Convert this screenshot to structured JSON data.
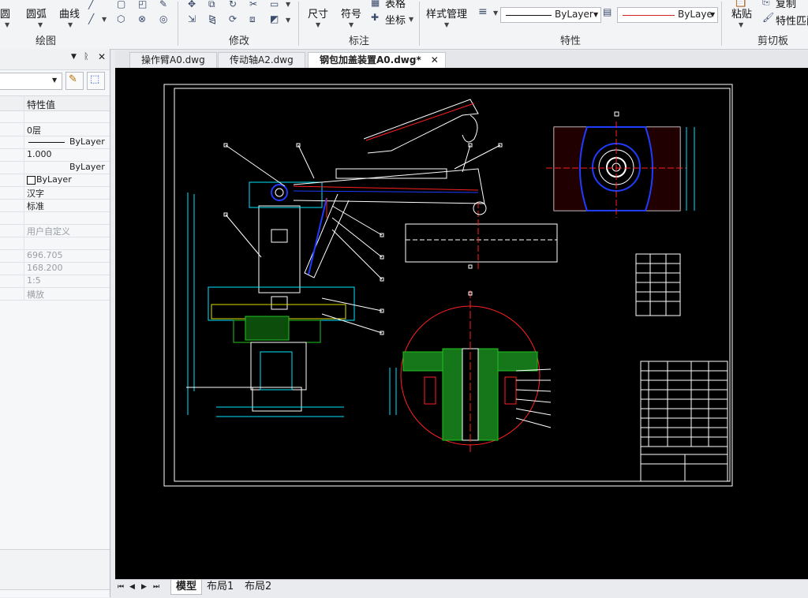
{
  "ribbon": {
    "draw_tools": {
      "circle_label": "圆",
      "arc_label": "圆弧",
      "curve_label": "曲线"
    },
    "groups": {
      "draw": "绘图",
      "modify": "修改",
      "annotate": "标注",
      "properties": "特性",
      "clipboard": "剪切板"
    },
    "annotate": {
      "dimension": "尺寸",
      "symbol": "符号",
      "table": "表格",
      "coordinate": "坐标"
    },
    "style_manager": "样式管理",
    "linetype_value": "ByLayer",
    "color_value": "ByLaye",
    "clipboard": {
      "paste": "粘贴",
      "copy": "复制",
      "match_properties": "特性匹配"
    },
    "accent_red": "#d42020"
  },
  "panel": {
    "header_value": "特性值",
    "rows": [
      {
        "value": "0层"
      },
      {
        "value": "ByLayer"
      },
      {
        "value": "1.000"
      },
      {
        "value": "ByLayer"
      },
      {
        "value": "ByLayer"
      },
      {
        "value": "汉字"
      },
      {
        "value": "标准"
      },
      {
        "value": ""
      },
      {
        "value": "用户自定义"
      },
      {
        "value": ""
      },
      {
        "value": "696.705"
      },
      {
        "value": "168.200"
      },
      {
        "value": "1:5"
      },
      {
        "value": "横放"
      }
    ]
  },
  "tabs": [
    {
      "label": "操作臂A0.dwg"
    },
    {
      "label": "传动轴A2.dwg"
    },
    {
      "label": "钢包加盖装置A0.dwg*"
    }
  ],
  "layout_tabs": {
    "model": "模型",
    "layout1": "布局1",
    "layout2": "布局2"
  },
  "colors": {
    "canvas": "#000000",
    "cyan": "#00e5ff",
    "blue": "#1f3cff",
    "red": "#ff2020",
    "green": "#22c322",
    "yellow": "#e0e000"
  }
}
